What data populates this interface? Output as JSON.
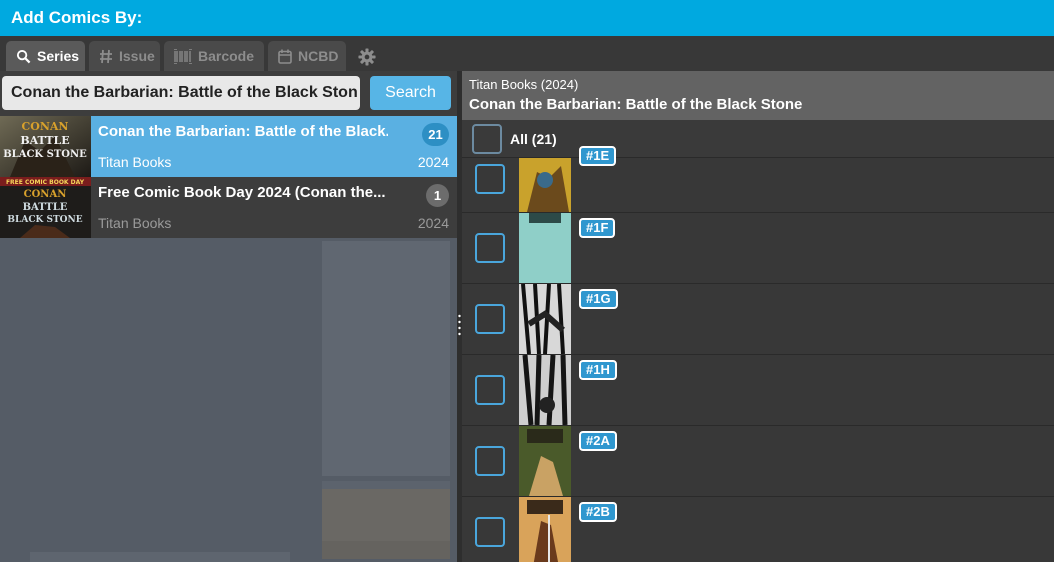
{
  "header": {
    "title": "Add Comics By:"
  },
  "tabs": [
    {
      "label": "Series",
      "icon": "search-icon",
      "active": true
    },
    {
      "label": "Issue",
      "icon": "hash-icon",
      "active": false
    },
    {
      "label": "Barcode",
      "icon": "barcode-icon",
      "active": false
    },
    {
      "label": "NCBD",
      "icon": "calendar-icon",
      "active": false
    }
  ],
  "settings_icon": "gear-icon",
  "search": {
    "value": "Conan the Barbarian: Battle of the Black Ston",
    "button_label": "Search"
  },
  "series_results": [
    {
      "name": "Conan the Barbarian: Battle of the Black...",
      "publisher": "Titan Books",
      "year": "2024",
      "count": "21",
      "selected": true,
      "cover_text": [
        "CONAN",
        "BATTLE",
        "BLACK STONE"
      ]
    },
    {
      "name": "Free Comic Book Day 2024 (Conan the...",
      "publisher": "Titan Books",
      "year": "2024",
      "count": "1",
      "selected": false,
      "cover_text": [
        "FREE COMIC BOOK DAY",
        "CONAN",
        "BATTLE",
        "BLACK STONE"
      ]
    }
  ],
  "detail": {
    "publisher_year": "Titan Books  (2024)",
    "series_title": "Conan the Barbarian: Battle of the Black Stone",
    "all_label": "All (21)"
  },
  "issues": [
    {
      "label": "#1E",
      "cover_color": "#c9a22c"
    },
    {
      "label": "#1F",
      "cover_color": "#8fcfc8"
    },
    {
      "label": "#1G",
      "cover_color": "#d8d8d8"
    },
    {
      "label": "#1H",
      "cover_color": "#cfcfcf"
    },
    {
      "label": "#2A",
      "cover_color": "#4a5a2a"
    },
    {
      "label": "#2B",
      "cover_color": "#d9a35a"
    }
  ],
  "colors": {
    "accent": "#00a9e0",
    "selected": "#5ab0e2",
    "badge": "#2f97cf"
  }
}
